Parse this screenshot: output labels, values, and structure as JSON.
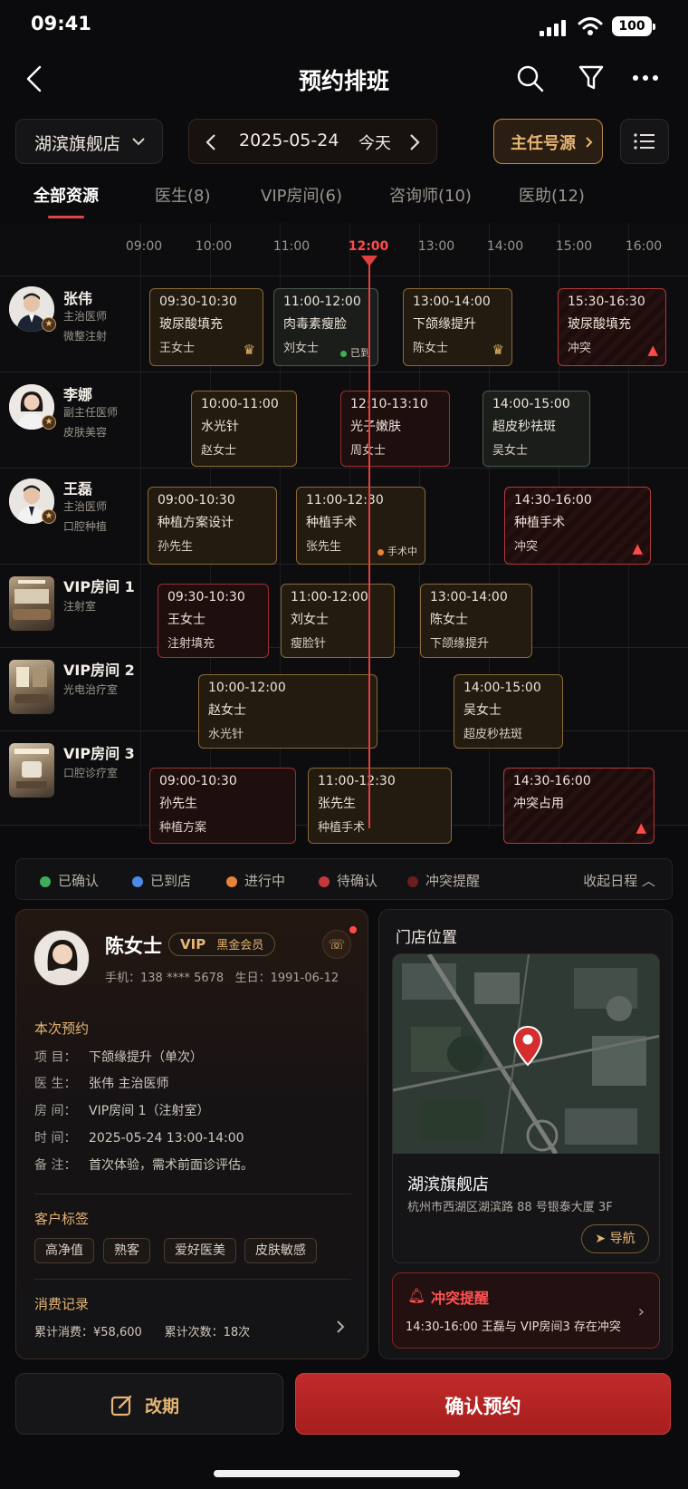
{
  "status": {
    "time": "09:41",
    "battery": "100"
  },
  "nav": {
    "title": "预约排班"
  },
  "controls": {
    "store": "湖滨旗舰店",
    "date": "2025-05-24",
    "today": "今天",
    "director": "主任号源"
  },
  "tabs": [
    "全部资源",
    "医生(8)",
    "VIP房间(6)",
    "咨询师(10)",
    "医助(12)"
  ],
  "hours": [
    "09:00",
    "10:00",
    "11:00",
    "12:00",
    "13:00",
    "14:00",
    "15:00",
    "16:00"
  ],
  "rows": [
    {
      "name": "张伟",
      "sub1": "主治医师",
      "sub2": "微整注射"
    },
    {
      "name": "李娜",
      "sub1": "副主任医师",
      "sub2": "皮肤美容"
    },
    {
      "name": "王磊",
      "sub1": "主治医师",
      "sub2": "口腔种植"
    },
    {
      "name": "VIP房间 1",
      "sub1": "注射室"
    },
    {
      "name": "VIP房间 2",
      "sub1": "光电治疗室"
    },
    {
      "name": "VIP房间 3",
      "sub1": "口腔诊疗室"
    }
  ],
  "events": [
    {
      "time": "09:30-10:30",
      "l2": "玻尿酸填充",
      "l3": "王女士",
      "icon": "crown"
    },
    {
      "time": "11:00-12:00",
      "l2": "肉毒素瘦脸",
      "l3": "刘女士",
      "status": "已到"
    },
    {
      "time": "13:00-14:00",
      "l2": "下颌缘提升",
      "l3": "陈女士",
      "icon": "crown"
    },
    {
      "time": "15:30-16:30",
      "l2": "玻尿酸填充",
      "l3": "冲突",
      "icon": "warning"
    },
    {
      "time": "10:00-11:00",
      "l2": "水光针",
      "l3": "赵女士"
    },
    {
      "time": "12:10-13:10",
      "l2": "光子嫩肤",
      "l3": "周女士"
    },
    {
      "time": "14:00-15:00",
      "l2": "超皮秒祛斑",
      "l3": "吴女士"
    },
    {
      "time": "09:00-10:30",
      "l2": "种植方案设计",
      "l3": "孙先生"
    },
    {
      "time": "11:00-12:30",
      "l2": "种植手术",
      "l3": "张先生",
      "status": "手术中"
    },
    {
      "time": "14:30-16:00",
      "l2": "种植手术",
      "l3": "冲突",
      "icon": "warning"
    },
    {
      "time": "09:30-10:30",
      "l2": "王女士",
      "l3": "注射填充"
    },
    {
      "time": "11:00-12:00",
      "l2": "刘女士",
      "l3": "瘦脸针"
    },
    {
      "time": "13:00-14:00",
      "l2": "陈女士",
      "l3": "下颌缘提升"
    },
    {
      "time": "10:00-12:00",
      "l2": "赵女士",
      "l3": "水光针"
    },
    {
      "time": "14:00-15:00",
      "l2": "吴女士",
      "l3": "超皮秒祛斑"
    },
    {
      "time": "09:00-10:30",
      "l2": "孙先生",
      "l3": "种植方案"
    },
    {
      "time": "11:00-12:30",
      "l2": "张先生",
      "l3": "种植手术"
    },
    {
      "time": "14:30-16:00",
      "l2": "冲突占用",
      "icon": "warning"
    }
  ],
  "legend": {
    "items": [
      {
        "label": "已确认",
        "color": "#3fae5a"
      },
      {
        "label": "已到店",
        "color": "#4a8ae8"
      },
      {
        "label": "进行中",
        "color": "#e8843a"
      },
      {
        "label": "待确认",
        "color": "#c43a3a"
      },
      {
        "label": "冲突提醒",
        "color": "#6a1e1e"
      }
    ],
    "collapse": "收起日程"
  },
  "customer": {
    "name": "陈女士",
    "vip": "VIP",
    "level": "黑金会员",
    "phone": "手机：138 **** 5678",
    "birthday": "生日：1991-06-12",
    "section_booking": "本次预约",
    "booking": [
      {
        "k": "项 目：",
        "v": "下颌缘提升（单次）"
      },
      {
        "k": "医 生：",
        "v": "张伟 主治医师"
      },
      {
        "k": "房 间：",
        "v": "VIP房间 1（注射室）"
      },
      {
        "k": "时 间：",
        "v": "2025-05-24 13:00-14:00"
      },
      {
        "k": "备 注：",
        "v": "首次体验，需术前面诊评估。"
      }
    ],
    "section_tags": "客户标签",
    "tags": [
      "高净值",
      "熟客",
      "爱好医美",
      "皮肤敏感"
    ],
    "section_spend": "消费记录",
    "spend_total": "累计消费：¥58,600",
    "spend_count": "累计次数：18次"
  },
  "store": {
    "title": "门店位置",
    "name": "湖滨旗舰店",
    "address": "杭州市西湖区湖滨路 88 号银泰大厦 3F",
    "navigate": "导航",
    "alert_title": "冲突提醒",
    "alert_desc": "14:30-16:00 王磊与 VIP房间3 存在冲突"
  },
  "actions": {
    "reschedule": "改期",
    "confirm": "确认预约"
  }
}
